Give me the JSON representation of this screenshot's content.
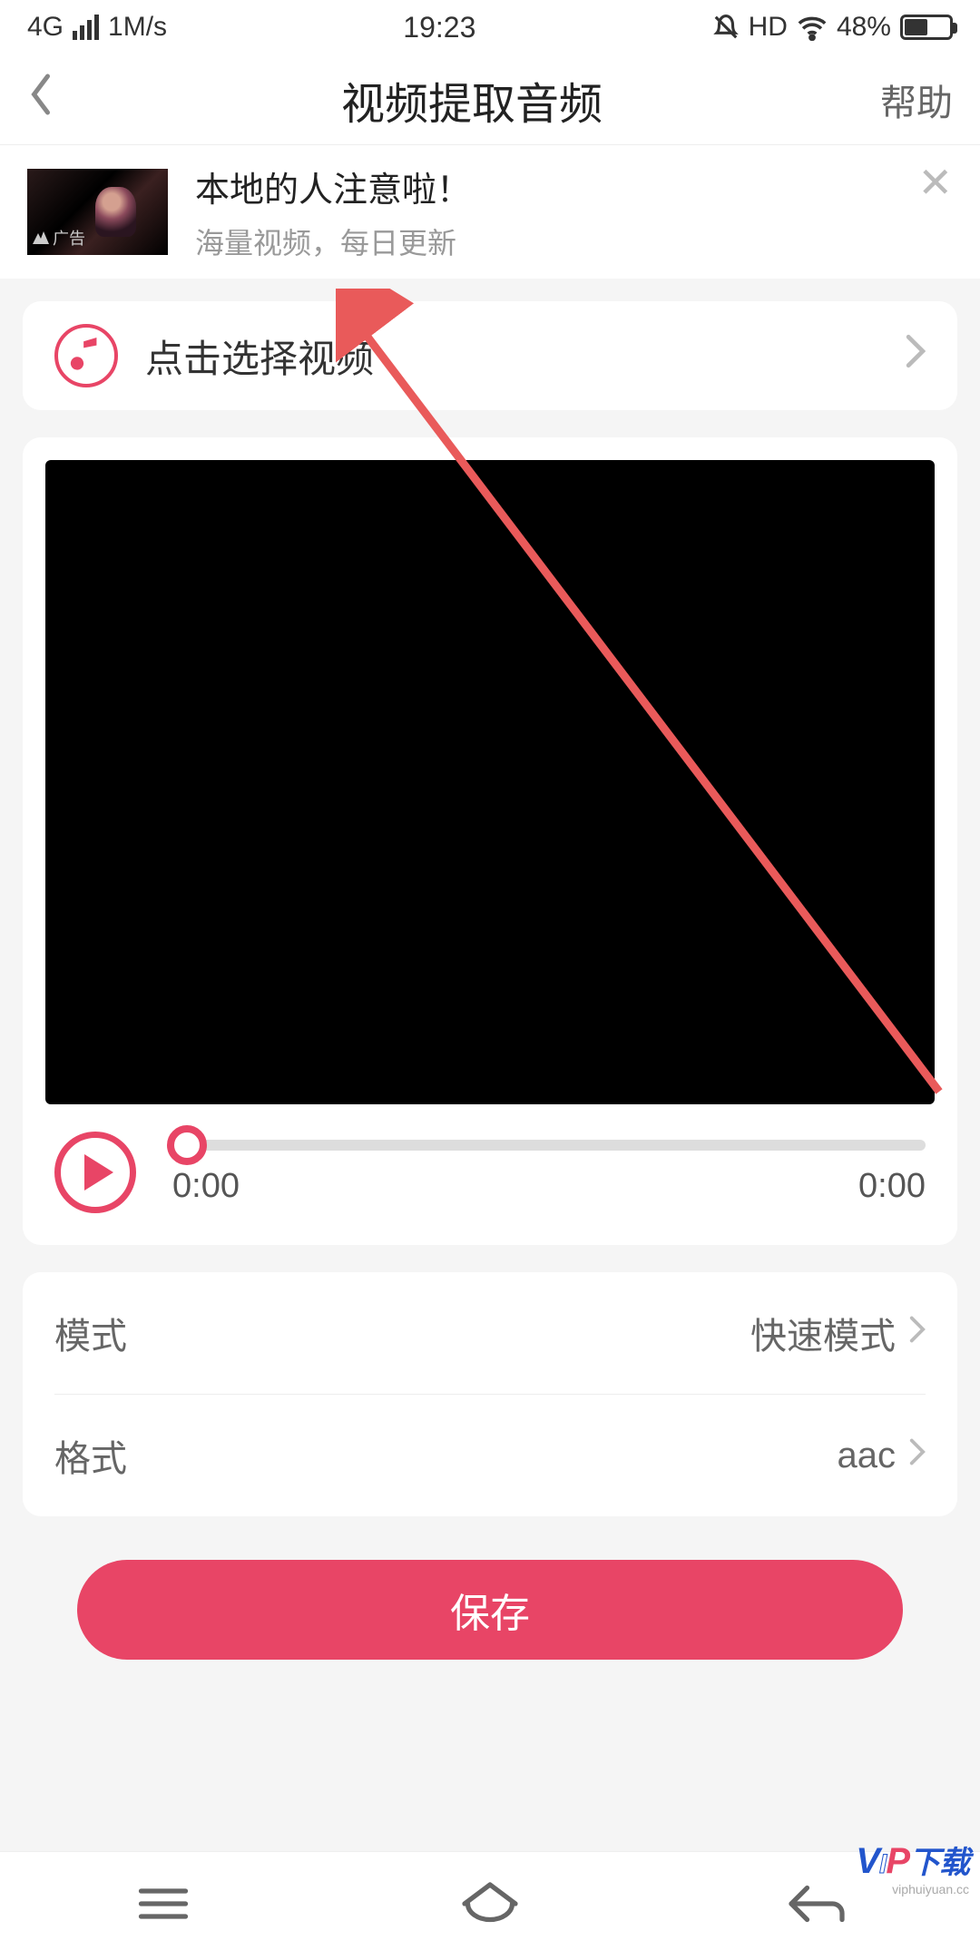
{
  "status": {
    "network": "4G",
    "speed": "1M/s",
    "time": "19:23",
    "hd": "HD",
    "battery": "48%"
  },
  "nav": {
    "title": "视频提取音频",
    "help": "帮助"
  },
  "ad": {
    "title": "本地的人注意啦！",
    "subtitle": "海量视频，每日更新",
    "badge": "广告"
  },
  "select": {
    "label": "点击选择视频"
  },
  "player": {
    "current": "0:00",
    "total": "0:00"
  },
  "settings": {
    "mode_label": "模式",
    "mode_value": "快速模式",
    "format_label": "格式",
    "format_value": "aac"
  },
  "actions": {
    "save": "保存"
  },
  "watermark": {
    "text": "下载",
    "url": "viphuiyuan.cc"
  },
  "annotation": {
    "color": "#e95a5a"
  }
}
